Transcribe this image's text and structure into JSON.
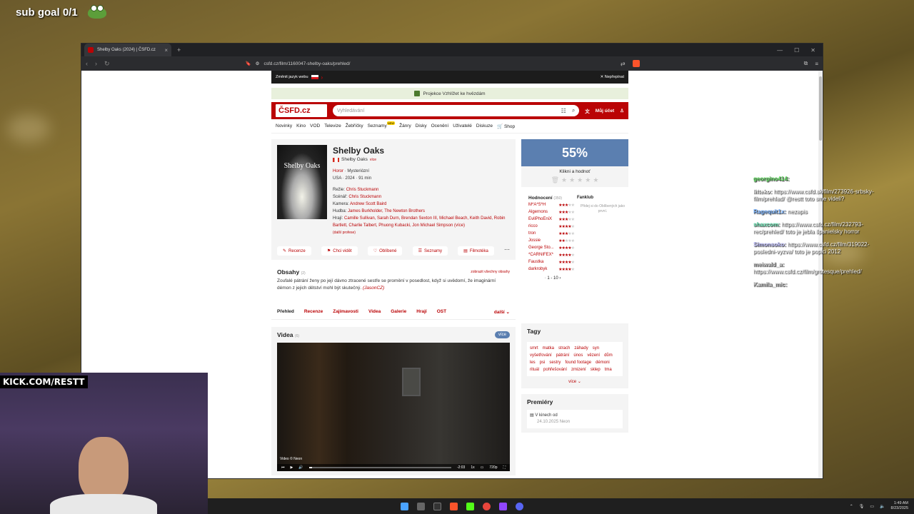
{
  "overlay": {
    "sub_goal": "sub goal 0/1"
  },
  "browser": {
    "tab_title": "Shelby Oaks (2024) | ČSFD.cz",
    "url": "csfd.cz/film/1160047-shelby-oaks/prehled/"
  },
  "site": {
    "lang_switch": "Změnit jazyk webu",
    "lang_close": "Nepřepínat",
    "promo": "Projekce Vzhlížet ke hvězdám",
    "logo": "ČSFD.cz",
    "search_placeholder": "Vyhledávání",
    "my_account": "Můj účet",
    "nav": [
      "Novinky",
      "Kino",
      "VOD",
      "Televize",
      "Žebříčky",
      "Seznamy",
      "Žánry",
      "Disky",
      "Ocenění",
      "Uživatelé",
      "Diskuze",
      "Shop"
    ],
    "new_badge": "NEW"
  },
  "film": {
    "poster_title": "Shelby Oaks",
    "title": "Shelby Oaks",
    "alt_title": "Shelby Oaks",
    "alt_more": "více",
    "genre1": "Horor",
    "genre2": "Mysteriózní",
    "origin": "USA",
    "year": "2024",
    "runtime": "91 min",
    "director_label": "Režie:",
    "director": "Chris Stuckmann",
    "writer_label": "Scénář:",
    "writer": "Chris Stuckmann",
    "camera_label": "Kamera:",
    "camera": "Andrew Scott Baird",
    "music_label": "Hudba:",
    "music": "James Burkholder, The Newton Brothers",
    "cast_label": "Hrají:",
    "cast": "Camille Sullivan, Sarah Durn, Brendan Sexton III, Michael Beach, Keith David, Robin Bartlett, Charlie Talbert, Phuong Kubacki, Jon Michael Simpson",
    "cast_more": "(více)",
    "more_professions": "(další profese)",
    "actions": [
      "Recenze",
      "Chci vidět",
      "Oblíbené",
      "Seznamy",
      "Filmotéka"
    ]
  },
  "plot": {
    "title": "Obsahy",
    "count": "(2)",
    "show_all": "zobrazit všechny obsahy",
    "text": "Zoufalé pátrání ženy po její dávno ztracené sestře se promění v posedlost, když si uvědomí, že imaginární démon z jejich dětství mohl být skutečný.",
    "author": "(JasonCZ)"
  },
  "tabs": [
    "Přehled",
    "Recenze",
    "Zajímavosti",
    "Videa",
    "Galerie",
    "Hrají",
    "OST"
  ],
  "tabs_more": "další",
  "videos": {
    "title": "Videa",
    "count": "(6)",
    "badge": "více",
    "credit": "Video © Neon",
    "time": "-2:03",
    "speed": "1x",
    "quality": "720p",
    "progress": 0.02
  },
  "rating": {
    "score": "55%",
    "rate_cta": "Klikni a hodnoť",
    "ratings_title": "Hodnocení",
    "ratings_count": "(350)",
    "fanklub_title": "Fanklub",
    "fanklub_note": "Přidej si do Oblíbených jako první.",
    "users": [
      {
        "name": "M*A*S*H",
        "stars": 3
      },
      {
        "name": "Algernons",
        "stars": 3
      },
      {
        "name": "EvilPhoEniX",
        "stars": 3
      },
      {
        "name": "ricco",
        "stars": 4
      },
      {
        "name": "tron",
        "stars": 3
      },
      {
        "name": "Jossie",
        "stars": 2
      },
      {
        "name": "George Sto...",
        "stars": 4
      },
      {
        "name": "*CARNIFEX*",
        "stars": 4
      },
      {
        "name": "Faustka",
        "stars": 4
      },
      {
        "name": "darkrobyk",
        "stars": 4
      }
    ],
    "pager": "1 - 10"
  },
  "tags": {
    "title": "Tagy",
    "items": [
      "smrt",
      "matka",
      "strach",
      "záhady",
      "syn",
      "vyšetřování",
      "pátrání",
      "únos",
      "vězení",
      "dům",
      "les",
      "psi",
      "sestry",
      "found footage",
      "démoni",
      "rituál",
      "pohřešování",
      "zmizení",
      "sklep",
      "tma"
    ],
    "more": "více"
  },
  "premieres": {
    "title": "Premiéry",
    "label": "V kinech od",
    "date": "24.10.2025 Neon"
  },
  "chat": [
    {
      "user": "georgino414:",
      "text": "",
      "user_color": "#5fdc5f"
    },
    {
      "user": "lifteko:",
      "text": "https://www.csfd.sk/film/273926-srbsky-film/prehlad/ @restt toto sme videli?",
      "user_color": "#ffffff"
    },
    {
      "user": "Ragequit1x:",
      "text": "nezapis",
      "user_color": "#7ab4ff"
    },
    {
      "user": "shaxcom:",
      "text": "https://www.csfd.cz/film/232793-rec/prehled/ toto je jebla španielsky horror",
      "user_color": "#6ee7b7"
    },
    {
      "user": "Simonsoko:",
      "text": "https://www.csfd.cz/film/319022-posledni-vyzva/ toto je popici 2012",
      "user_color": "#c0c0ff"
    },
    {
      "user": "meiwald_a:",
      "text": "https://www.csfd.cz/film/grotesque/prehled/",
      "user_color": "#d0d0d0"
    },
    {
      "user": "Kamila_mic:",
      "text": "",
      "user_color": "#d0d0d0"
    }
  ],
  "webcam": {
    "brand": "KICK.COM/RESTT"
  },
  "taskbar": {
    "time": "1:49 AM",
    "date": "8/23/2025"
  }
}
